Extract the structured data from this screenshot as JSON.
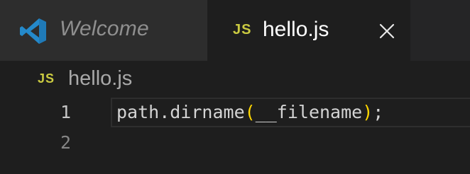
{
  "tabs": [
    {
      "label": "Welcome",
      "icon": "vscode-icon",
      "active": false
    },
    {
      "label": "hello.js",
      "badge": "JS",
      "icon": "close-icon",
      "active": true
    }
  ],
  "breadcrumb": {
    "badge": "JS",
    "label": "hello.js"
  },
  "editor": {
    "line_numbers": [
      "1",
      "2"
    ],
    "code": {
      "before": "path.dirname",
      "open_paren": "(",
      "argument": "__filename",
      "close_paren": ")",
      "after": ";"
    }
  },
  "colors": {
    "background": "#1e1e1e",
    "tab_bar": "#252526",
    "inactive_tab": "#2d2d2d",
    "js_badge": "#cbcb41",
    "bracket": "#ffd700",
    "vscode_blue": "#2489ca"
  }
}
